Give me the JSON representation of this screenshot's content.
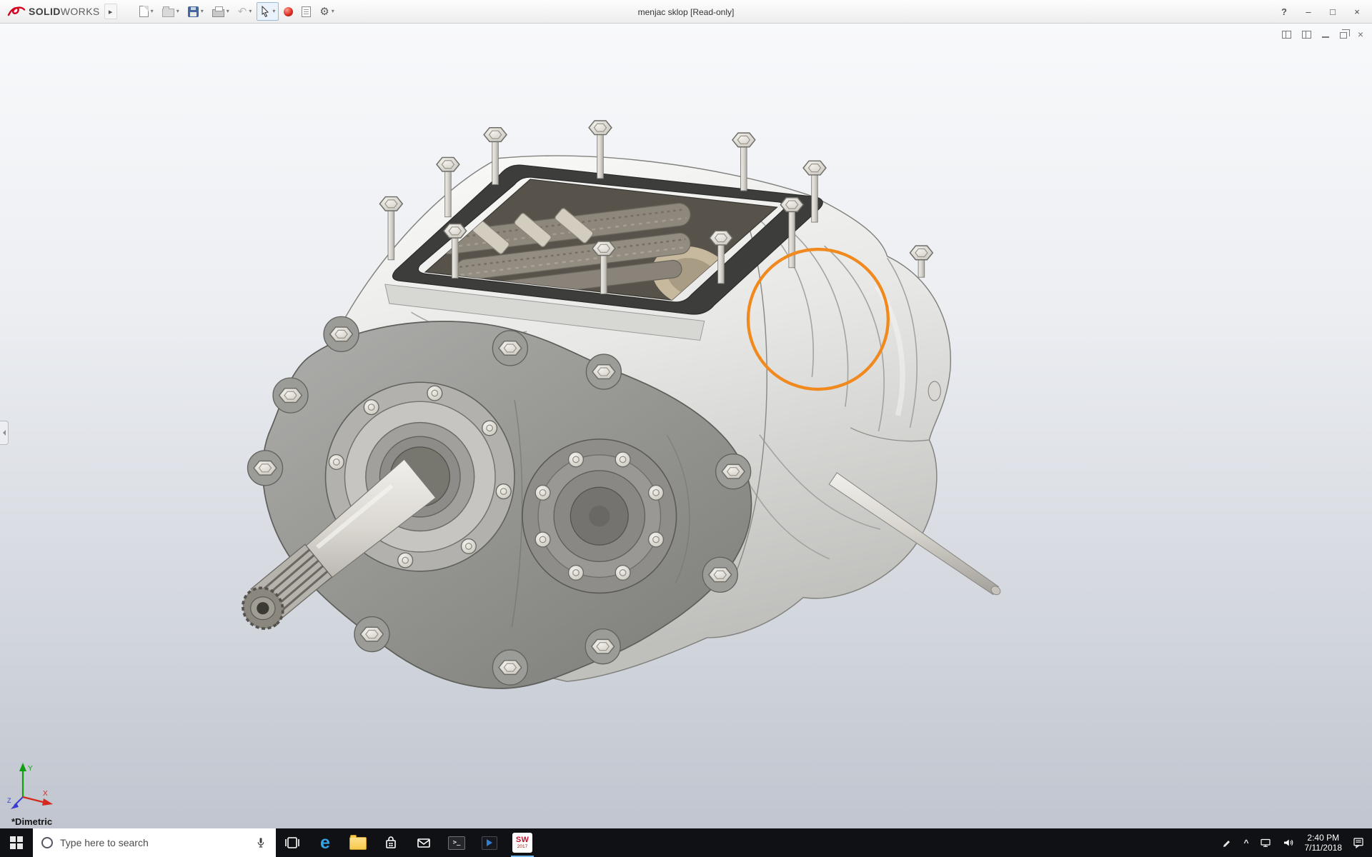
{
  "titlebar": {
    "brand_bold": "SOLID",
    "brand_light": "WORKS",
    "document_title": "menjac sklop [Read-only]",
    "help_label": "?",
    "window_controls": {
      "minimize": "–",
      "maximize": "□",
      "close": "×"
    }
  },
  "glyphs": {
    "dropdown": "▾",
    "expand": "▸",
    "undo": "↶",
    "gear": "⚙",
    "hidden_icons": "^"
  },
  "doc_window_controls": {
    "minimize_note": "",
    "close": "×"
  },
  "viewport": {
    "orientation_label": "*Dimetric",
    "triad": {
      "x_label": "X",
      "y_label": "Y",
      "z_label": "Z"
    },
    "annotation_color": "#F08A1E"
  },
  "taskbar": {
    "search_placeholder": "Type here to search",
    "edge_glyph": "e",
    "console_glyph": ">_",
    "solidworks_badge": {
      "label": "SW",
      "year": "2017"
    },
    "clock_time": "2:40 PM",
    "clock_date": "7/11/2018"
  }
}
